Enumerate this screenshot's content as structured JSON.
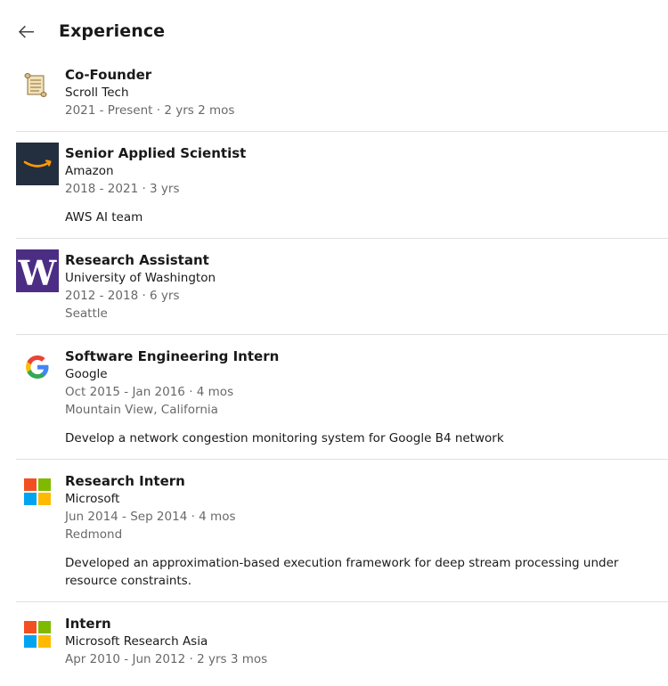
{
  "header": {
    "title": "Experience"
  },
  "experience": [
    {
      "role": "Co-Founder",
      "company": "Scroll Tech",
      "dates": "2021 - Present · 2 yrs 2 mos",
      "location": "",
      "description": "",
      "logo_icon": "scroll-icon"
    },
    {
      "role": "Senior Applied Scientist",
      "company": "Amazon",
      "dates": "2018 - 2021 · 3 yrs",
      "location": "",
      "description": "AWS AI team",
      "logo_icon": "amazon-logo-icon"
    },
    {
      "role": "Research Assistant",
      "company": "University of Washington",
      "dates": "2012 - 2018 · 6 yrs",
      "location": "Seattle",
      "description": "",
      "logo_icon": "uw-logo-icon"
    },
    {
      "role": "Software Engineering Intern",
      "company": "Google",
      "dates": "Oct 2015 - Jan 2016 · 4 mos",
      "location": "Mountain View, California",
      "description": "Develop a network congestion monitoring system for Google B4 network",
      "logo_icon": "google-logo-icon"
    },
    {
      "role": "Research Intern",
      "company": "Microsoft",
      "dates": "Jun 2014 - Sep 2014 · 4 mos",
      "location": "Redmond",
      "description": "Developed an approximation-based execution framework for deep stream processing under resource constraints.",
      "logo_icon": "microsoft-logo-icon"
    },
    {
      "role": "Intern",
      "company": "Microsoft Research Asia",
      "dates": "Apr 2010 - Jun 2012 · 2 yrs 3 mos",
      "location": "",
      "description": "",
      "logo_icon": "microsoft-logo-icon"
    }
  ],
  "colors": {
    "amazon_bg": "#232f3e",
    "amazon_smile": "#ff9900",
    "uw_purple": "#4b2e83",
    "ms_red": "#f25022",
    "ms_green": "#7fba00",
    "ms_blue": "#00a4ef",
    "ms_yellow": "#ffb900",
    "divider": "#e0e0e0",
    "meta_text": "rgba(0,0,0,0.6)"
  }
}
